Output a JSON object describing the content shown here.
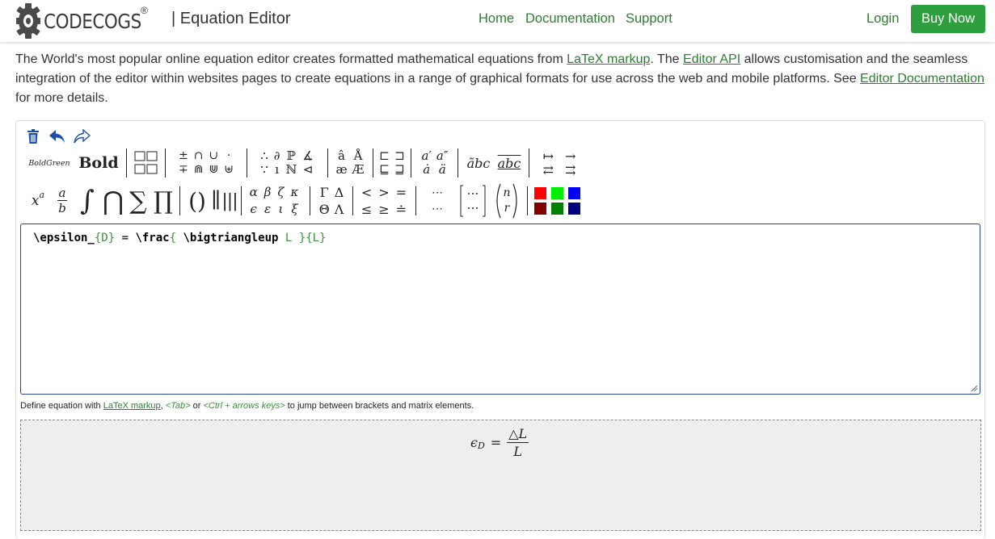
{
  "brand": {
    "name": "CODECOGS",
    "registered_mark": "®"
  },
  "header": {
    "app_title": "| Equation Editor",
    "nav": {
      "home": "Home",
      "documentation": "Documentation",
      "support": "Support",
      "login": "Login"
    },
    "buy_now": "Buy Now"
  },
  "intro": {
    "t1": "The World's most popular online equation editor creates formatted mathematical equations from ",
    "link_latex": "LaTeX markup",
    "t2": ". The ",
    "link_api": "Editor API",
    "t3": " allows customisation and the seamless integration of the editor within websites pages to create equations in a range of graphical formats for use across the web and mobile platforms. See ",
    "link_doc": "Editor Documentation",
    "t4": " for more details."
  },
  "toolbar_row1": {
    "bold_green": "BoldGreen",
    "bold": "Bold",
    "ops": [
      "±",
      "∩",
      "∪",
      "·",
      "∓",
      "⋒",
      "⋓",
      "⊎"
    ],
    "logic": [
      "∴",
      "∂",
      "ℙ",
      "∡",
      "∵",
      "ı",
      "ℕ",
      "⊲"
    ],
    "accents": [
      "â",
      "Å",
      "æ",
      "Æ"
    ],
    "subsets": [
      "⊏",
      "⊐",
      "⊑",
      "⊒"
    ],
    "primes": [
      "a′",
      "a″",
      "ȧ",
      "ä"
    ],
    "wide": [
      "ãbc",
      "abc"
    ],
    "arrows": [
      "↦",
      "→",
      "⇄",
      "⇉"
    ]
  },
  "toolbar_row2": {
    "power_base": "x",
    "power_exp": "a",
    "frac_num": "a",
    "frac_den": "b",
    "big_ops": [
      "∫",
      "⋂",
      "∑",
      "∏"
    ],
    "delims": [
      "(",
      ")",
      "∥",
      "|||"
    ],
    "greek_lower": [
      "α",
      "β",
      "ζ",
      "κ",
      "ϵ",
      "ε",
      "ι",
      "ξ"
    ],
    "greek_upper": [
      "Γ",
      "Δ",
      "Θ",
      "Λ"
    ],
    "relations": [
      "<",
      ">",
      "=",
      "≤",
      "≥",
      "≐"
    ],
    "dots": [
      "⋯",
      "⋯"
    ],
    "matrix": "⋯",
    "binom_n": "n",
    "binom_r": "r"
  },
  "colors": [
    "#ff0000",
    "#00ee00",
    "#0000ff",
    "#800000",
    "#008000",
    "#000080"
  ],
  "editor": {
    "tok1": "\\epsilon_",
    "tok2": "{D}",
    "tok3": " = ",
    "tok4": "\\frac",
    "tok5": "{ ",
    "tok6": "\\bigtriangleup",
    "tok7": " L }{L}"
  },
  "hint": {
    "t1": "Define equation with ",
    "link": "LaTeX markup",
    "t2": ", ",
    "tab": "<Tab>",
    "t3": " or ",
    "keys": "<Ctrl + arrows keys>",
    "t4": " to jump between brackets and matrix elements."
  },
  "preview": {
    "lhs": "ϵ",
    "sub": "D",
    "eq": "=",
    "num": "△L",
    "den": "L"
  }
}
